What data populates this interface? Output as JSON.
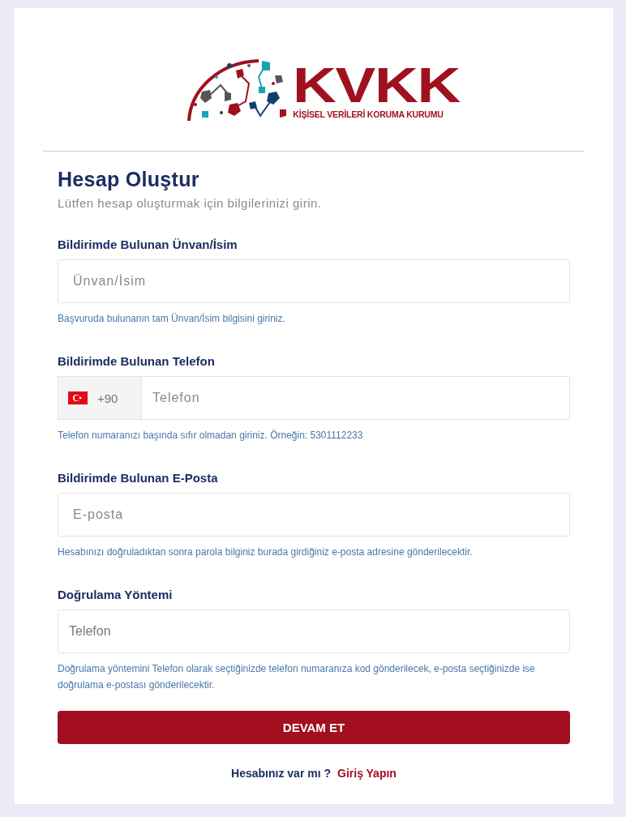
{
  "logo": {
    "wordmark": "KVKK",
    "subtitle": "KİŞİSEL VERİLERİ KORUMA KURUMU"
  },
  "title": "Hesap Oluştur",
  "subtitle": "Lütfen hesap oluşturmak için bilgilerinizi girin.",
  "fields": [
    {
      "kind": "text",
      "label": "Bildirimde Bulunan Ünvan/İsim",
      "placeholder": "Ünvan/İsim",
      "help": "Başvuruda bulunanın tam Ünvan/İsim bilgisini giriniz."
    },
    {
      "kind": "phone",
      "label": "Bildirimde Bulunan Telefon",
      "prefix": "+90",
      "placeholder": "Telefon",
      "help": "Telefon numaranızı başında sıfır olmadan giriniz. Örneğin: 5301112233"
    },
    {
      "kind": "text",
      "label": "Bildirimde Bulunan E-Posta",
      "placeholder": "E-posta",
      "help": "Hesabınızı doğruladıktan sonra parola bilginiz burada girdiğiniz e-posta adresine gönderilecektir."
    },
    {
      "kind": "select",
      "label": "Doğrulama Yöntemi",
      "value": "Telefon",
      "help": "Doğrulama yöntemini Telefon olarak seçtiğinizde telefon numaranıza kod gönderilecek, e-posta seçtiğinizde ise doğrulama e-postası gönderilecektir."
    }
  ],
  "submit": "DEVAM ET",
  "footer": {
    "question": "Hesabınız var mı ?",
    "link": "Giriş Yapın"
  }
}
